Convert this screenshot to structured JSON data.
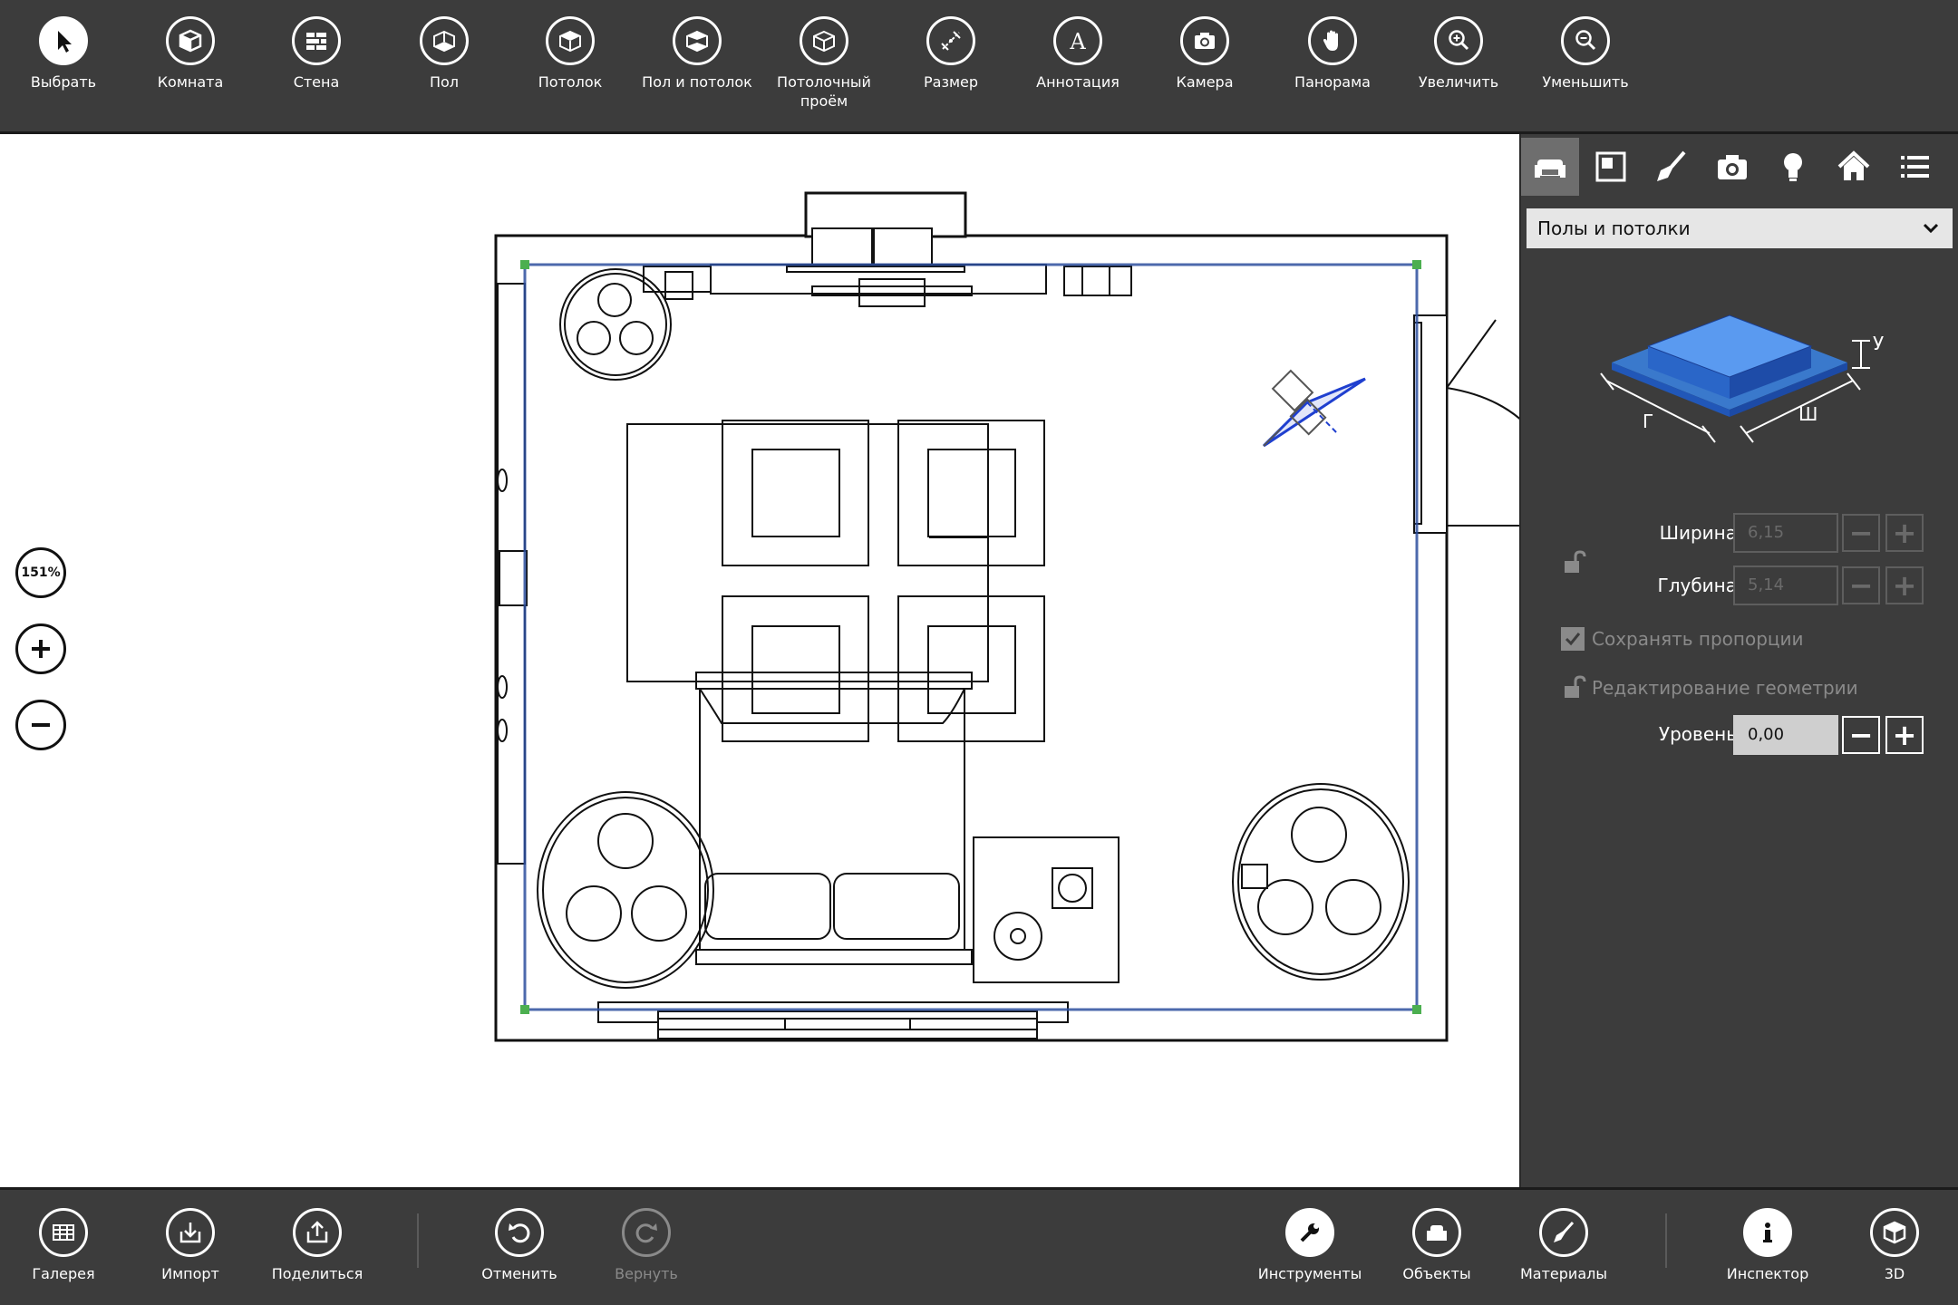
{
  "toolbar": {
    "items": [
      {
        "label": "Выбрать",
        "icon": "arrow-pointer-icon"
      },
      {
        "label": "Комната",
        "icon": "room-cube-icon"
      },
      {
        "label": "Стена",
        "icon": "wall-bricks-icon"
      },
      {
        "label": "Пол",
        "icon": "floor-icon"
      },
      {
        "label": "Потолок",
        "icon": "ceiling-icon"
      },
      {
        "label": "Пол и потолок",
        "icon": "floor-and-ceiling-icon"
      },
      {
        "label": "Потолочный проём",
        "icon": "ceiling-opening-icon"
      },
      {
        "label": "Размер",
        "icon": "dimension-icon"
      },
      {
        "label": "Аннотация",
        "icon": "annotation-a-icon"
      },
      {
        "label": "Камера",
        "icon": "camera-icon"
      },
      {
        "label": "Панорама",
        "icon": "hand-pan-icon"
      },
      {
        "label": "Увеличить",
        "icon": "zoom-in-icon"
      },
      {
        "label": "Уменьшить",
        "icon": "zoom-out-icon"
      }
    ]
  },
  "zoom": {
    "percent": "151%"
  },
  "inspector": {
    "tabs": [
      "furniture-icon",
      "floor-plan-icon",
      "brush-icon",
      "camera-icon",
      "lightbulb-icon",
      "house-icon",
      "list-icon"
    ],
    "dropdown_value": "Полы и потолки",
    "diagram_labels": {
      "depth": "Г",
      "width": "Ш",
      "height": "У"
    },
    "width_label": "Ширина",
    "width_value": "6,15",
    "depth_label": "Глубина",
    "depth_value": "5,14",
    "keep_proportions": "Сохранять пропорции",
    "edit_geometry": "Редактирование геометрии",
    "level_label": "Уровень",
    "level_value": "0,00"
  },
  "bottombar": {
    "gallery": "Галерея",
    "import": "Импорт",
    "share": "Поделиться",
    "undo": "Отменить",
    "redo": "Вернуть",
    "tools": "Инструменты",
    "objects": "Объекты",
    "materials": "Материалы",
    "inspector": "Инспектор",
    "view3d": "3D"
  },
  "colors": {
    "bar": "#3c3c3c",
    "selection": "#2d4f9e",
    "accent_blue": "#1f5fd1",
    "handle": "#4caf50"
  }
}
